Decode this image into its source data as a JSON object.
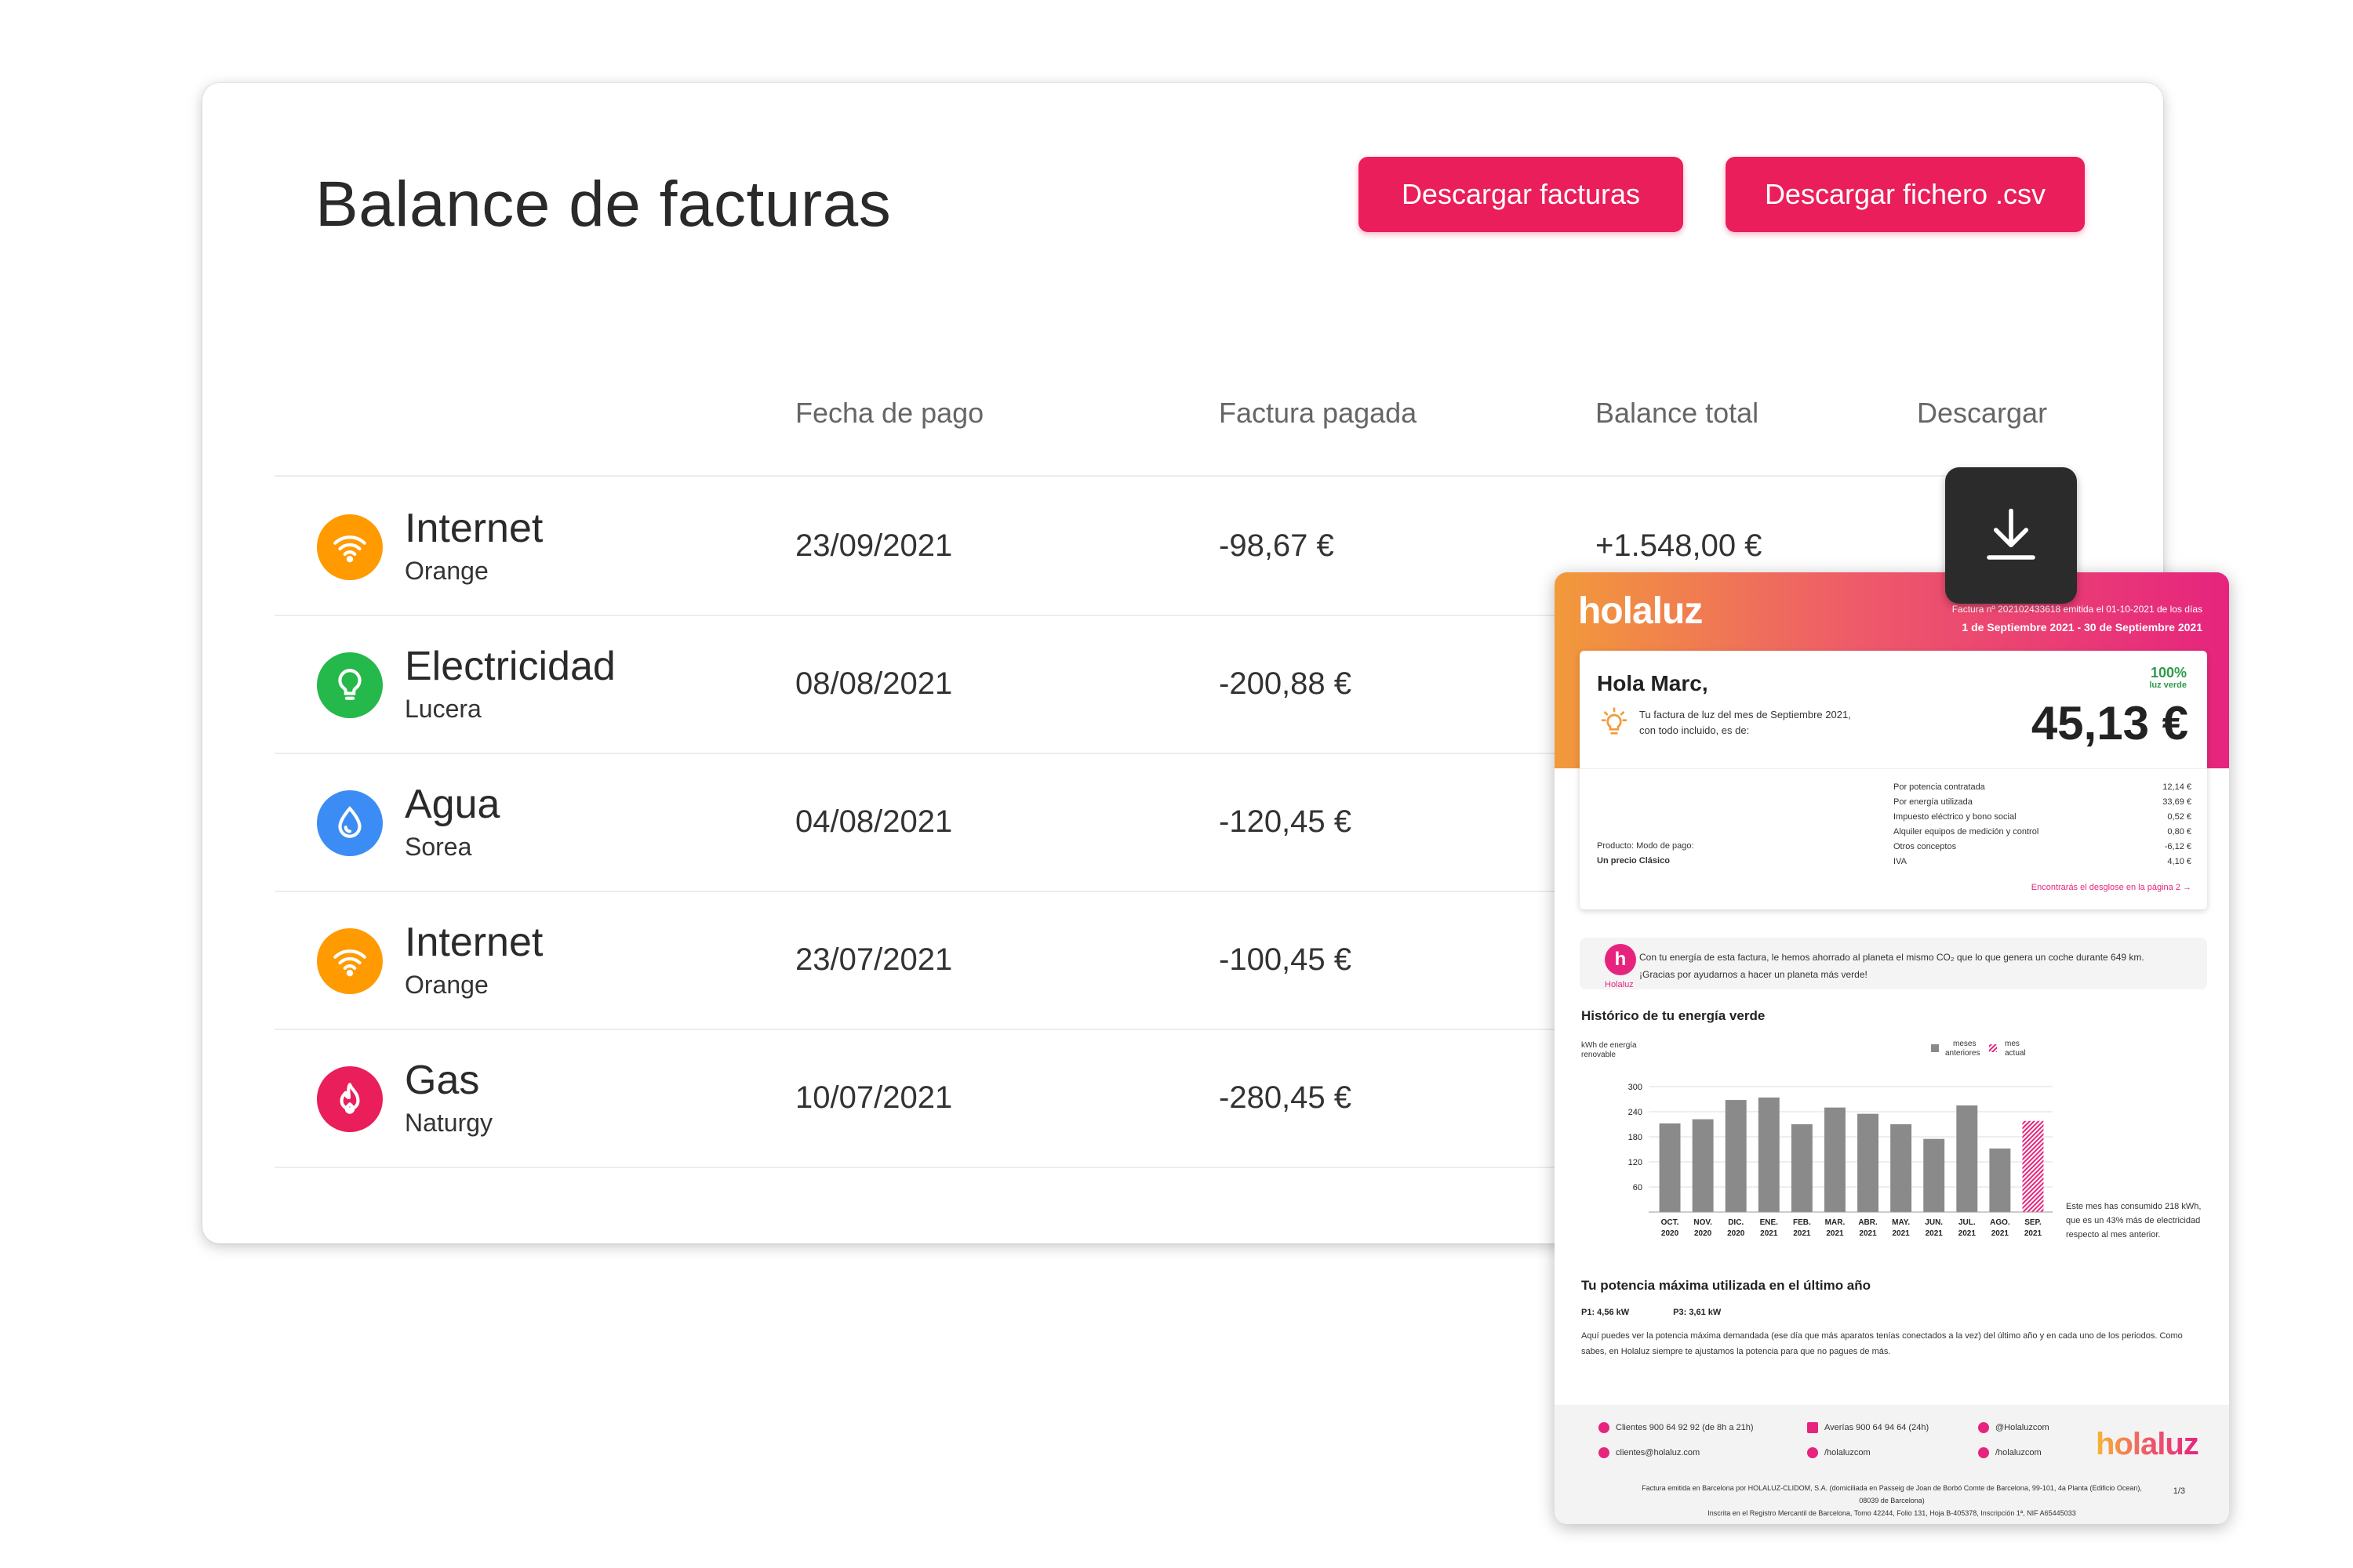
{
  "page": {
    "title": "Balance de facturas",
    "buttons": {
      "download_invoices": "Descargar  facturas",
      "download_csv": "Descargar fichero .csv"
    }
  },
  "table": {
    "headers": {
      "fecha": "Fecha de pago",
      "factura": "Factura pagada",
      "balance": "Balance total",
      "descargar": "Descargar"
    },
    "rows": [
      {
        "service": "Internet",
        "provider": "Orange",
        "icon": "wifi-icon",
        "color": "#ff9a00",
        "fecha": "23/09/2021",
        "factura": "-98,67 €",
        "balance": "+1.548,00 €"
      },
      {
        "service": "Electricidad",
        "provider": "Lucera",
        "icon": "lightbulb-icon",
        "color": "#25b84a",
        "fecha": "08/08/2021",
        "factura": "-200,88 €",
        "balance": ""
      },
      {
        "service": "Agua",
        "provider": "Sorea",
        "icon": "water-drop-icon",
        "color": "#3b8df5",
        "fecha": "04/08/2021",
        "factura": "-120,45 €",
        "balance": ""
      },
      {
        "service": "Internet",
        "provider": "Orange",
        "icon": "wifi-icon",
        "color": "#ff9a00",
        "fecha": "23/07/2021",
        "factura": "-100,45 €",
        "balance": ""
      },
      {
        "service": "Gas",
        "provider": "Naturgy",
        "icon": "flame-icon",
        "color": "#ea1e5a",
        "fecha": "10/07/2021",
        "factura": "-280,45 €",
        "balance": ""
      }
    ]
  },
  "invoice": {
    "logo": "holaluz",
    "meta_line1": "Factura nº 202102433618 emitida el 01-10-2021 de los días",
    "meta_line2": "1 de Septiembre 2021 - 30 de Septiembre 2021",
    "greeting": "Hola Marc,",
    "green_pct": "100%",
    "green_label": "luz verde",
    "message_line1": "Tu factura de luz del mes de Septiembre 2021,",
    "message_line2": "con todo incluido, es de:",
    "total": "45,13 €",
    "product_labels": "Producto:   Modo de pago:",
    "product_values": "Un precio   Clásico",
    "breakdown": [
      {
        "label": "Por potencia contratada",
        "value": "12,14 €"
      },
      {
        "label": "Por energía utilizada",
        "value": "33,69 €"
      },
      {
        "label": "Impuesto eléctrico y bono social",
        "value": "0,52 €"
      },
      {
        "label": "Alquiler equipos de medición y control",
        "value": "0,80 €"
      },
      {
        "label": "Otros conceptos",
        "value": "-6,12 €"
      },
      {
        "label": "IVA",
        "value": "4,10 €"
      }
    ],
    "breakdown_link": "Encontrarás el desglose en la página 2 →",
    "co2_label": "Holaluz",
    "co2_line1": "Con tu energía de esta factura, le hemos ahorrado al planeta el mismo CO₂ que lo que genera un coche durante 649 km.",
    "co2_line2": "¡Gracias por ayudarnos a hacer un planeta más verde!",
    "history_title": "Histórico de tu energía verde",
    "side_note": "Este mes has consumido 218 kWh, que es un 43% más de electricidad respecto al mes anterior.",
    "power_title": "Tu potencia máxima utilizada en el último año",
    "p1": "P1: 4,56 kW",
    "p3": "P3: 3,61 kW",
    "power_text": "Aquí puedes ver la potencia máxima demandada (ese día que más aparatos tenías conectados a la vez) del último año y en cada uno de los periodos. Como sabes, en Holaluz siempre te ajustamos la potencia para que no pagues de más.",
    "footer": {
      "clientes": "Clientes 900 64 92 92 (de 8h a 21h)",
      "averias": "Averías 900 64 94 64 (24h)",
      "twitter": "@Holaluzcom",
      "email": "clientes@holaluz.com",
      "instagram": "/holaluzcom",
      "facebook": "/holaluzcom",
      "legal1": "Factura emitida en Barcelona por HOLALUZ-CLIDOM, S.A. (domiciliada en Passeig de Joan de Borbó Comte de Barcelona, 99-101, 4a Planta (Edificio Ocean), 08039 de Barcelona)",
      "legal2": "Inscrita en el Registro Mercantil de Barcelona, Tomo 42244, Folio 131, Hoja B-405378, Inscripción 1ª, NIF A65445033",
      "page": "1/3"
    }
  },
  "chart_data": {
    "type": "bar",
    "ylabel": "kWh de energía renovable",
    "ylim": [
      0,
      300
    ],
    "yticks": [
      60,
      120,
      180,
      240,
      300
    ],
    "legend": [
      "meses anteriores",
      "mes actual"
    ],
    "legend_position": "top-right",
    "categories": [
      "OCT. 2020",
      "NOV. 2020",
      "DIC. 2020",
      "ENE. 2021",
      "FEB. 2021",
      "MAR. 2021",
      "ABR. 2021",
      "MAY. 2021",
      "JUN. 2021",
      "JUL. 2021",
      "AGO. 2021",
      "SEP. 2021"
    ],
    "values": [
      212,
      222,
      268,
      274,
      210,
      250,
      235,
      210,
      175,
      255,
      152,
      218
    ],
    "colors": {
      "previous": "#8a8a8a",
      "current": "#e6247e"
    }
  }
}
